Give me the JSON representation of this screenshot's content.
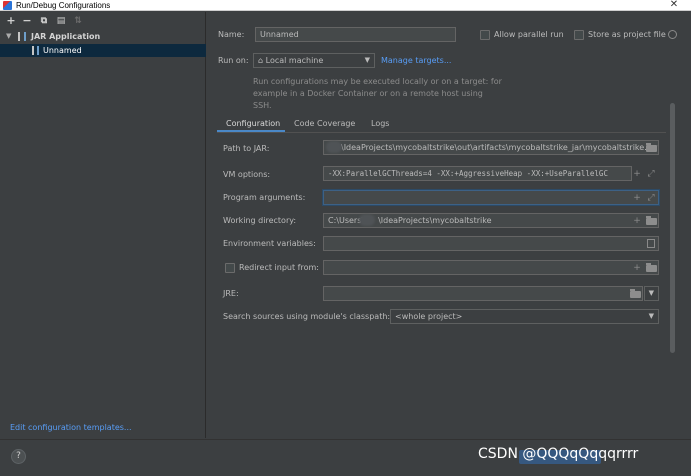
{
  "window": {
    "title": "Run/Debug Configurations"
  },
  "toolbar": {
    "add": "+",
    "remove": "−",
    "copy": "⧉",
    "folder": "▤",
    "sort": "⇅"
  },
  "tree": {
    "group_label": "JAR Application",
    "item_label": "Unnamed"
  },
  "left_footer": {
    "templates_link": "Edit configuration templates..."
  },
  "form": {
    "name_label": "Name:",
    "name_value": "Unnamed",
    "allow_parallel_label": "Allow parallel run",
    "store_as_file_label": "Store as project file",
    "run_on_label": "Run on:",
    "run_on_value": "Local machine",
    "manage_targets": "Manage targets...",
    "hint": "Run configurations may be executed locally or on a target: for example in a Docker Container or on a remote host using SSH."
  },
  "tabs": [
    "Configuration",
    "Code Coverage",
    "Logs"
  ],
  "config": {
    "path_label": "Path to JAR:",
    "path_value": "\\IdeaProjects\\mycobaltstrike\\out\\artifacts\\mycobaltstrike_jar\\mycobaltstrike.jar",
    "vm_label": "VM options:",
    "vm_value": "-XX:ParallelGCThreads=4 -XX:+AggressiveHeap -XX:+UseParallelGC",
    "args_label": "Program arguments:",
    "args_value": "",
    "workdir_label": "Working directory:",
    "workdir_prefix": "C:\\Users\\",
    "workdir_suffix": "\\IdeaProjects\\mycobaltstrike",
    "env_label": "Environment variables:",
    "env_value": "",
    "redirect_label": "Redirect input from:",
    "jre_label": "JRE:",
    "classpath_label": "Search sources using module's classpath:",
    "classpath_value": "<whole project>"
  },
  "footer": {
    "help": "?",
    "watermark": "CSDN @QQQqQqqqrrrr"
  }
}
